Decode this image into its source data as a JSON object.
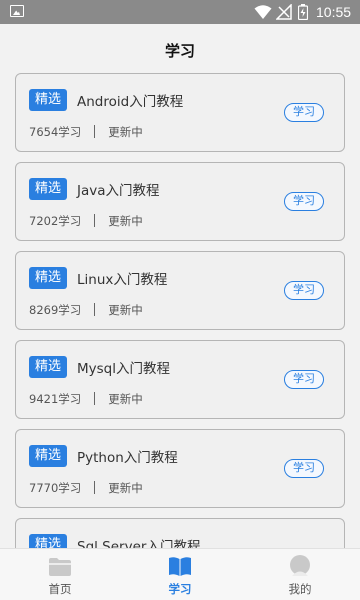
{
  "status_bar": {
    "time": "10:55",
    "icons": [
      "image-icon",
      "wifi-icon",
      "signal-icon",
      "battery-icon"
    ]
  },
  "app_bar": {
    "title": "学习"
  },
  "courses": [
    {
      "badge": "精选",
      "title": "Android入门教程",
      "learners": "7654学习",
      "status": "更新中",
      "action": "学习"
    },
    {
      "badge": "精选",
      "title": "Java入门教程",
      "learners": "7202学习",
      "status": "更新中",
      "action": "学习"
    },
    {
      "badge": "精选",
      "title": "Linux入门教程",
      "learners": "8269学习",
      "status": "更新中",
      "action": "学习"
    },
    {
      "badge": "精选",
      "title": "Mysql入门教程",
      "learners": "9421学习",
      "status": "更新中",
      "action": "学习"
    },
    {
      "badge": "精选",
      "title": "Python入门教程",
      "learners": "7770学习",
      "status": "更新中",
      "action": "学习"
    },
    {
      "badge": "精选",
      "title": "Sql Server入门教程",
      "learners": "",
      "status": "",
      "action": ""
    }
  ],
  "tabs": [
    {
      "label": "首页",
      "icon": "home-icon",
      "active": false
    },
    {
      "label": "学习",
      "icon": "book-icon",
      "active": true
    },
    {
      "label": "我的",
      "icon": "profile-icon",
      "active": false
    }
  ],
  "colors": {
    "accent": "#2a7fe0",
    "status_bar": "#8a8a8a",
    "background": "#f2f2f2"
  }
}
